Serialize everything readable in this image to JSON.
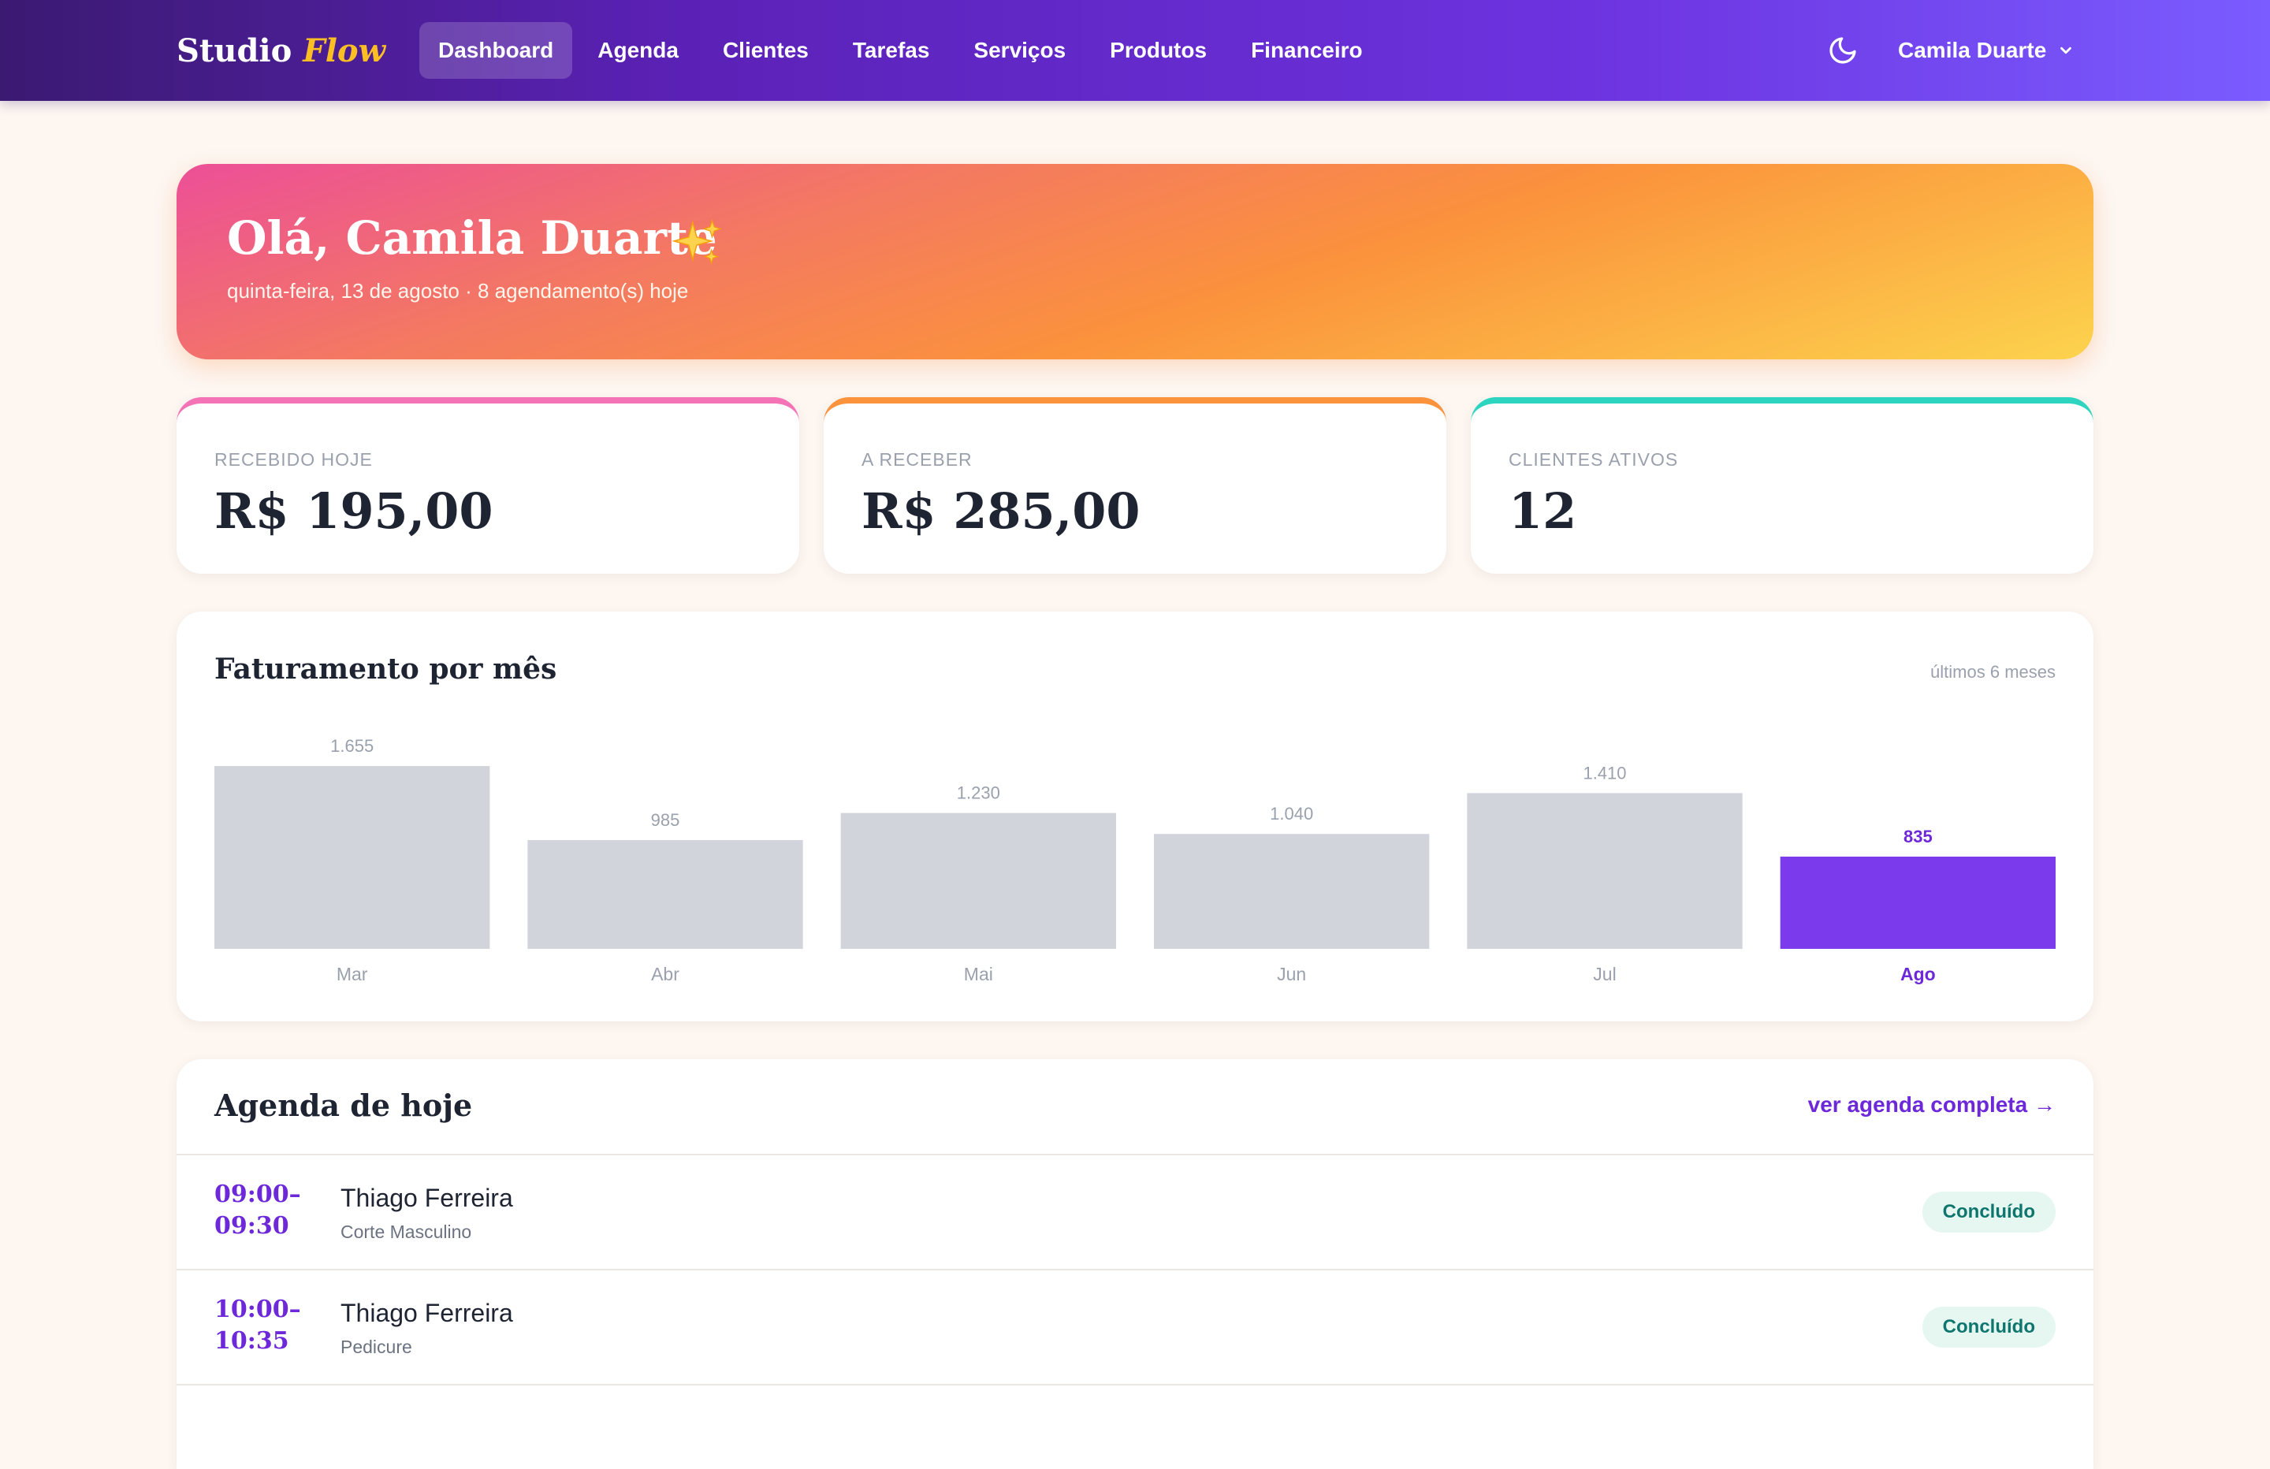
{
  "nav": {
    "brand_main": "Studio",
    "brand_accent": "Flow",
    "links": [
      {
        "label": "Dashboard",
        "active": true
      },
      {
        "label": "Agenda",
        "active": false
      },
      {
        "label": "Clientes",
        "active": false
      },
      {
        "label": "Tarefas",
        "active": false
      },
      {
        "label": "Serviços",
        "active": false
      },
      {
        "label": "Produtos",
        "active": false
      },
      {
        "label": "Financeiro",
        "active": false
      }
    ],
    "theme_icon": "moon-icon",
    "user_name": "Camila Duarte",
    "user_menu_icon": "chevron-down-icon"
  },
  "hero": {
    "title": "Olá, Camila Duarte",
    "emoji_icon": "sparkles-icon",
    "subtitle": "quinta-feira, 13 de agosto · 8 agendamento(s) hoje"
  },
  "stats": [
    {
      "label": "RECEBIDO HOJE",
      "value": "R$ 195,00",
      "accent": "#f472b6"
    },
    {
      "label": "A RECEBER",
      "value": "R$ 285,00",
      "accent": "#fb923c"
    },
    {
      "label": "CLIENTES ATIVOS",
      "value": "12",
      "accent": "#2dd4bf"
    }
  ],
  "chart": {
    "title": "Faturamento por mês",
    "note": "últimos 6 meses"
  },
  "chart_data": {
    "type": "bar",
    "categories": [
      "Mar",
      "Abr",
      "Mai",
      "Jun",
      "Jul",
      "Ago"
    ],
    "values": [
      1655,
      985,
      1230,
      1040,
      1410,
      835
    ],
    "value_labels": [
      "1.655",
      "985",
      "1.230",
      "1.040",
      "1.410",
      "835"
    ],
    "highlight_index": 5,
    "colors": {
      "default": "#d1d5db",
      "highlight": "#7c3aed",
      "label": "#9aa1ad",
      "highlight_label": "#6d28d9"
    },
    "title": "Faturamento por mês",
    "xlabel": "",
    "ylabel": "",
    "grid": false
  },
  "agenda": {
    "title": "Agenda de hoje",
    "link": "ver agenda completa →",
    "items": [
      {
        "start": "09:00–",
        "end": "09:30",
        "client": "Thiago Ferreira",
        "service": "Corte Masculino",
        "status": "Concluído"
      },
      {
        "start": "10:00–",
        "end": "10:35",
        "client": "Thiago Ferreira",
        "service": "Pedicure",
        "status": "Concluído"
      }
    ]
  }
}
